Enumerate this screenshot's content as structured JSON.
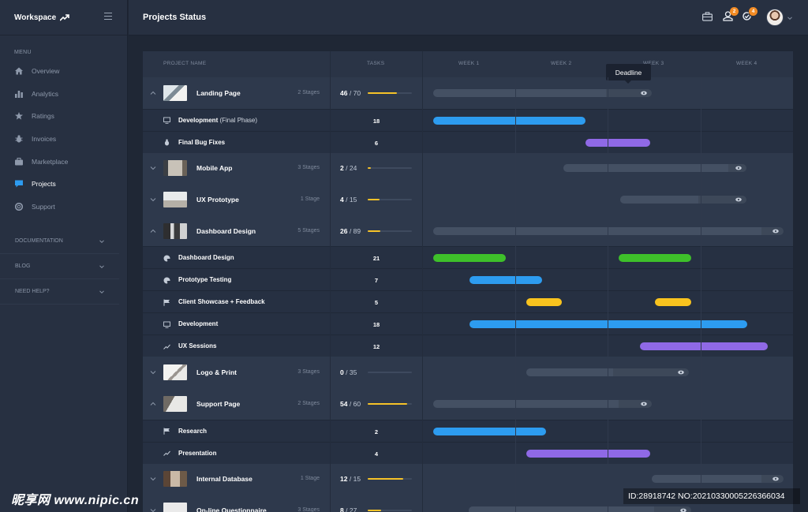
{
  "sidebar": {
    "brand": "Workspace",
    "menu_title": "MENU",
    "items": [
      {
        "label": "Overview",
        "icon": "home-icon"
      },
      {
        "label": "Analytics",
        "icon": "bar-chart-icon"
      },
      {
        "label": "Ratings",
        "icon": "star-icon"
      },
      {
        "label": "Invoices",
        "icon": "bug-icon"
      },
      {
        "label": "Marketplace",
        "icon": "briefcase-icon"
      },
      {
        "label": "Projects",
        "icon": "chat-bubble-icon",
        "active": true
      },
      {
        "label": "Support",
        "icon": "lifebuoy-icon"
      }
    ],
    "sections": [
      "DOCUMENTATION",
      "BLOG",
      "NEED HELP?"
    ]
  },
  "header": {
    "title": "Projects Status",
    "notifications": [
      {
        "icon": "briefcase-icon",
        "badge": ""
      },
      {
        "icon": "user-alert-icon",
        "badge": "2"
      },
      {
        "icon": "refresh-check-icon",
        "badge": "4"
      }
    ]
  },
  "table": {
    "columns": {
      "project": "PROJECT NAME",
      "tasks": "TASKS",
      "weeks": [
        "WEEK 1",
        "WEEK 2",
        "WEEK 3",
        "WEEK 4"
      ]
    },
    "tooltip": "Deadline"
  },
  "rows": [
    {
      "kind": "project",
      "name": "Landing Page",
      "stages": "2 Stages",
      "done": "46",
      "total": "70",
      "progress": 0.66,
      "expanded": true
    },
    {
      "kind": "task",
      "name": "Development",
      "note": "(Final Phase)",
      "icon": "monitor-icon",
      "count": "18"
    },
    {
      "kind": "task",
      "name": "Final Bug Fixes",
      "note": "",
      "icon": "bug-icon",
      "count": "6"
    },
    {
      "kind": "project",
      "name": "Mobile App",
      "stages": "3 Stages",
      "done": "2",
      "total": "24",
      "progress": 0.08,
      "expanded": false
    },
    {
      "kind": "project",
      "name": "UX Prototype",
      "stages": "1 Stage",
      "done": "4",
      "total": "15",
      "progress": 0.27,
      "expanded": false
    },
    {
      "kind": "project",
      "name": "Dashboard Design",
      "stages": "5 Stages",
      "done": "26",
      "total": "89",
      "progress": 0.29,
      "expanded": true
    },
    {
      "kind": "task",
      "name": "Dashboard Design",
      "note": "",
      "icon": "palette-icon",
      "count": "21"
    },
    {
      "kind": "task",
      "name": "Prototype Testing",
      "note": "",
      "icon": "palette-icon",
      "count": "7"
    },
    {
      "kind": "task",
      "name": "Client Showcase + Feedback",
      "note": "",
      "icon": "flag-icon",
      "count": "5"
    },
    {
      "kind": "task",
      "name": "Development",
      "note": "",
      "icon": "monitor-icon",
      "count": "18"
    },
    {
      "kind": "task",
      "name": "UX Sessions",
      "note": "",
      "icon": "trend-icon",
      "count": "12"
    },
    {
      "kind": "project",
      "name": "Logo & Print",
      "stages": "3 Stages",
      "done": "0",
      "total": "35",
      "progress": 0.0,
      "expanded": false
    },
    {
      "kind": "project",
      "name": "Support Page",
      "stages": "2 Stages",
      "done": "54",
      "total": "60",
      "progress": 0.9,
      "expanded": true
    },
    {
      "kind": "task",
      "name": "Research",
      "note": "",
      "icon": "flag-icon",
      "count": "2"
    },
    {
      "kind": "task",
      "name": "Presentation",
      "note": "",
      "icon": "trend-icon",
      "count": "4"
    },
    {
      "kind": "project",
      "name": "Internal Database",
      "stages": "1 Stage",
      "done": "12",
      "total": "15",
      "progress": 0.8,
      "expanded": false
    },
    {
      "kind": "project",
      "name": "On-line Questionnaire",
      "stages": "3 Stages",
      "done": "8",
      "total": "27",
      "progress": 0.3,
      "expanded": false
    }
  ],
  "timeline": {
    "weeks_total": 4,
    "projects": [
      {
        "start": 0.12,
        "end": 2.48,
        "done_until": 1.98
      },
      {
        "start": 1.52,
        "end": 3.5,
        "done_until": 3.3
      },
      {
        "start": 2.14,
        "end": 3.5,
        "done_until": 2.98
      },
      {
        "start": 0.12,
        "end": 3.9,
        "done_until": 3.66
      },
      {
        "start": 1.12,
        "end": 2.88,
        "done_until": 2.06
      },
      {
        "start": 0.12,
        "end": 2.48,
        "done_until": 2.12
      },
      {
        "start": 2.48,
        "end": 3.9,
        "done_until": 3.66
      },
      {
        "start": 0.5,
        "end": 2.9,
        "done_until": 2.5
      }
    ],
    "colors": {
      "blue": "#2d9cf0",
      "purple": "#8f69e6",
      "green": "#3ec02a",
      "yellow": "#f8c31e"
    },
    "tasks": [
      {
        "bars": [
          {
            "start": 0.12,
            "end": 1.76,
            "color": "blue"
          }
        ]
      },
      {
        "bars": [
          {
            "start": 1.76,
            "end": 2.46,
            "color": "purple"
          }
        ]
      },
      {
        "bars": [
          {
            "start": 0.12,
            "end": 0.9,
            "color": "green"
          },
          {
            "start": 2.12,
            "end": 2.9,
            "color": "green"
          }
        ]
      },
      {
        "bars": [
          {
            "start": 0.51,
            "end": 1.29,
            "color": "blue"
          }
        ]
      },
      {
        "bars": [
          {
            "start": 1.12,
            "end": 1.51,
            "color": "yellow"
          },
          {
            "start": 2.51,
            "end": 2.9,
            "color": "yellow"
          }
        ]
      },
      {
        "bars": [
          {
            "start": 0.51,
            "end": 3.51,
            "color": "blue"
          }
        ]
      },
      {
        "bars": [
          {
            "start": 2.35,
            "end": 3.73,
            "color": "purple"
          }
        ]
      },
      {
        "bars": [
          {
            "start": 0.12,
            "end": 1.34,
            "color": "blue"
          }
        ]
      },
      {
        "bars": [
          {
            "start": 1.12,
            "end": 2.46,
            "color": "purple"
          }
        ]
      }
    ]
  },
  "watermark": {
    "logo": "昵享网 www.nipic.cn",
    "id": "ID:28918742 NO:20210330005226366034"
  }
}
